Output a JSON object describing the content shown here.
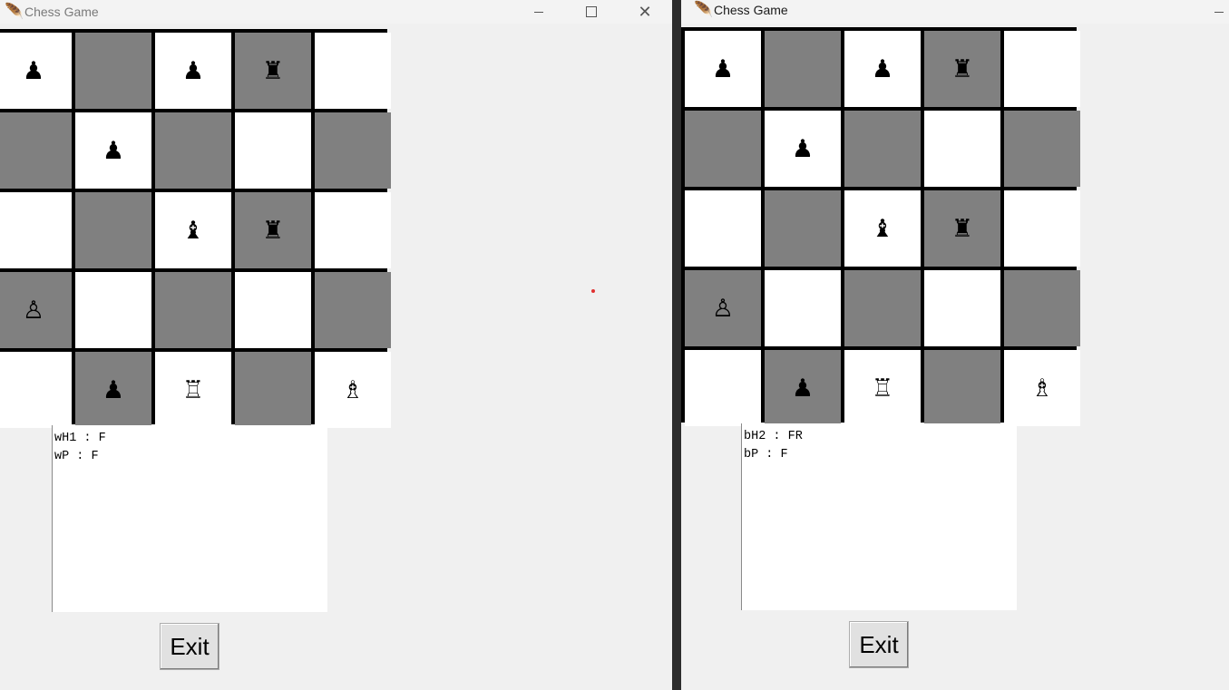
{
  "windows": [
    {
      "id": "left",
      "title": "Chess Game",
      "title_icon": "feather-icon",
      "board": [
        [
          {
            "color": "w",
            "piece": "♟"
          },
          {
            "color": "g",
            "piece": ""
          },
          {
            "color": "w",
            "piece": "♟"
          },
          {
            "color": "g",
            "piece": "♜"
          },
          {
            "color": "w",
            "piece": ""
          }
        ],
        [
          {
            "color": "g",
            "piece": ""
          },
          {
            "color": "w",
            "piece": "♟"
          },
          {
            "color": "g",
            "piece": ""
          },
          {
            "color": "w",
            "piece": ""
          },
          {
            "color": "g",
            "piece": ""
          }
        ],
        [
          {
            "color": "w",
            "piece": ""
          },
          {
            "color": "g",
            "piece": ""
          },
          {
            "color": "w",
            "piece": "♝"
          },
          {
            "color": "g",
            "piece": "♜"
          },
          {
            "color": "w",
            "piece": ""
          }
        ],
        [
          {
            "color": "g",
            "piece": "♙"
          },
          {
            "color": "w",
            "piece": ""
          },
          {
            "color": "g",
            "piece": ""
          },
          {
            "color": "w",
            "piece": ""
          },
          {
            "color": "g",
            "piece": ""
          }
        ],
        [
          {
            "color": "w",
            "piece": ""
          },
          {
            "color": "g",
            "piece": "♟"
          },
          {
            "color": "w",
            "piece": "♖"
          },
          {
            "color": "g",
            "piece": ""
          },
          {
            "color": "w",
            "piece": "♗"
          }
        ]
      ],
      "log_lines": [
        "wH1 : F",
        "wP : F"
      ],
      "exit_label": "Exit"
    },
    {
      "id": "right",
      "title": "Chess Game",
      "title_icon": "feather-icon",
      "board": [
        [
          {
            "color": "w",
            "piece": "♟"
          },
          {
            "color": "g",
            "piece": ""
          },
          {
            "color": "w",
            "piece": "♟"
          },
          {
            "color": "g",
            "piece": "♜"
          },
          {
            "color": "w",
            "piece": ""
          }
        ],
        [
          {
            "color": "g",
            "piece": ""
          },
          {
            "color": "w",
            "piece": "♟"
          },
          {
            "color": "g",
            "piece": ""
          },
          {
            "color": "w",
            "piece": ""
          },
          {
            "color": "g",
            "piece": ""
          }
        ],
        [
          {
            "color": "w",
            "piece": ""
          },
          {
            "color": "g",
            "piece": ""
          },
          {
            "color": "w",
            "piece": "♝"
          },
          {
            "color": "g",
            "piece": "♜"
          },
          {
            "color": "w",
            "piece": ""
          }
        ],
        [
          {
            "color": "g",
            "piece": "♙"
          },
          {
            "color": "w",
            "piece": ""
          },
          {
            "color": "g",
            "piece": ""
          },
          {
            "color": "w",
            "piece": ""
          },
          {
            "color": "g",
            "piece": ""
          }
        ],
        [
          {
            "color": "w",
            "piece": ""
          },
          {
            "color": "g",
            "piece": "♟"
          },
          {
            "color": "w",
            "piece": "♖"
          },
          {
            "color": "g",
            "piece": ""
          },
          {
            "color": "w",
            "piece": "♗"
          }
        ]
      ],
      "log_lines": [
        "bH2 : FR",
        "bP : F"
      ],
      "exit_label": "Exit"
    }
  ],
  "colors": {
    "light_square": "#ffffff",
    "dark_square": "#808080",
    "board_border": "#000000",
    "window_bg": "#f0f0f0"
  }
}
